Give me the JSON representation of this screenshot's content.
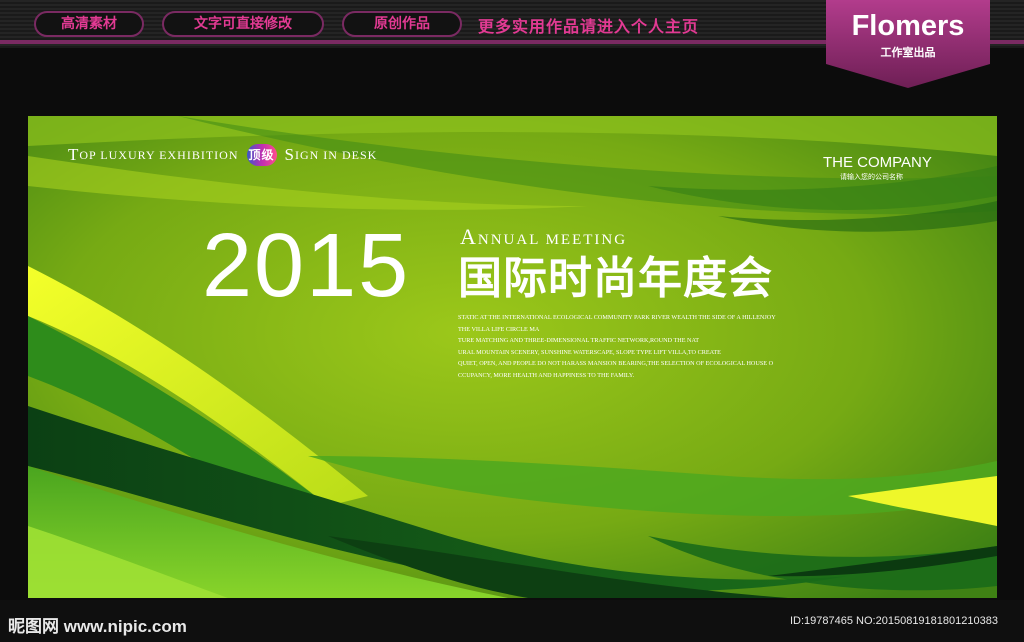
{
  "top_bar": {
    "buttons": [
      "高清素材",
      "文字可直接修改",
      "原创作品"
    ],
    "tagline": "更多实用作品请进入个人主页"
  },
  "badge": {
    "title": "Flomers",
    "subtitle": "工作室出品"
  },
  "poster": {
    "top_line": {
      "part1_initial": "T",
      "part1_rest": "OP LUXURY EXHIBITION",
      "badge": "顶级",
      "part2_initial": "S",
      "part2_rest": "IGN IN DESK"
    },
    "company": "THE COMPANY",
    "company_sub": "请输入您的公司名称",
    "year": "2015",
    "annual_initial": "A",
    "annual_rest": "NNUAL MEETING",
    "title_cn": "国际时尚年度会",
    "paragraph_lines": [
      "STATIC AT THE INTERNATIONAL ECOLOGICAL COMMUNITY PARK RIVER WEALTH THE SIDE OF A HILLENJOY",
      "THE VILLA LIFE CIRCLE MA",
      "TURE MATCHING AND THREE-DIMENSIONAL TRAFFIC NETWORK,ROUND THE NAT",
      "URAL MOUNTAIN SCENERY, SUNSHINE WATERSCAPE, SLOPE TYPE LIFT VILLA,TO CREATE",
      "QUIET, OPEN, AND PEOPLE DO NOT HARASS MANSION BEARING,THE SELECTION OF ECOLOGICAL HOUSE O",
      "CCUPANCY, MORE HEALTH AND HAPPINESS TO THE FAMILY."
    ],
    "colors": {
      "base": "#6fa315",
      "light_yellow": "#e5f21f",
      "dark_green": "#0f4f16",
      "mid_green": "#2e8c1b"
    }
  },
  "footer": {
    "site_cn": "昵图网",
    "site_url": "www.nipic.com",
    "id_text": "ID:19787465 NO:20150819181801210383"
  },
  "colors": {
    "accent_pink": "#e23a93",
    "badge_purple": "#8a2a6c"
  }
}
